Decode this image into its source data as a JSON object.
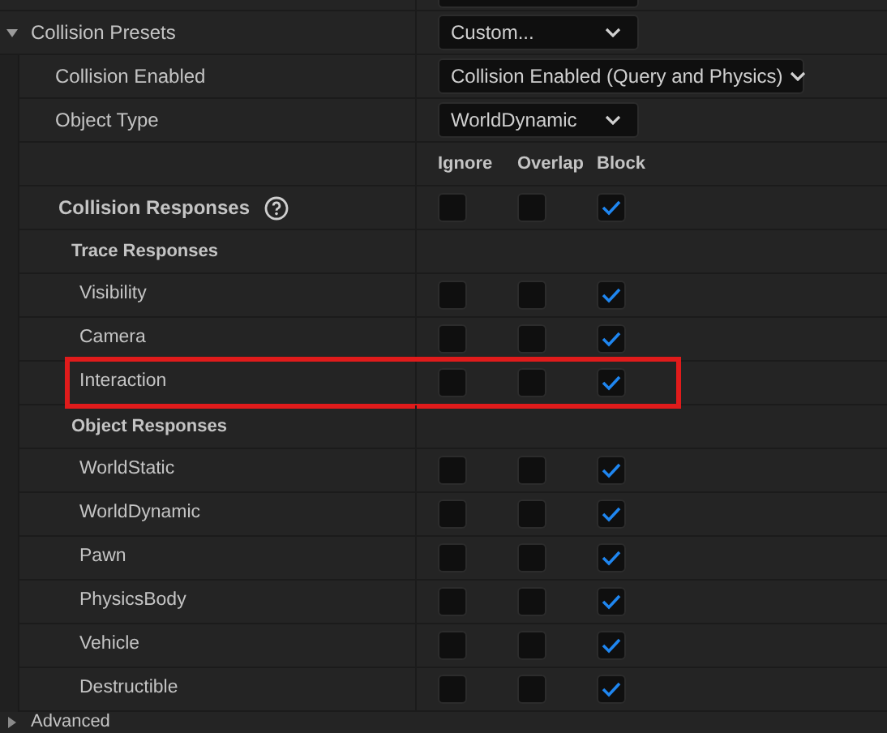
{
  "presets": {
    "label": "Collision Presets",
    "value": "Custom...",
    "expanded": true
  },
  "properties": [
    {
      "label": "Collision Enabled",
      "value": "Collision Enabled (Query and Physics)",
      "wide": true
    },
    {
      "label": "Object Type",
      "value": "WorldDynamic",
      "wide": false
    }
  ],
  "columns": [
    "Ignore",
    "Overlap",
    "Block"
  ],
  "responses": {
    "label": "Collision Responses",
    "ignore": false,
    "overlap": false,
    "block": true
  },
  "groups": [
    {
      "title": "Trace Responses",
      "items": [
        {
          "label": "Visibility",
          "ignore": false,
          "overlap": false,
          "block": true,
          "highlighted": false
        },
        {
          "label": "Camera",
          "ignore": false,
          "overlap": false,
          "block": true,
          "highlighted": false
        },
        {
          "label": "Interaction",
          "ignore": false,
          "overlap": false,
          "block": true,
          "highlighted": true
        }
      ]
    },
    {
      "title": "Object Responses",
      "items": [
        {
          "label": "WorldStatic",
          "ignore": false,
          "overlap": false,
          "block": true,
          "highlighted": false
        },
        {
          "label": "WorldDynamic",
          "ignore": false,
          "overlap": false,
          "block": true,
          "highlighted": false
        },
        {
          "label": "Pawn",
          "ignore": false,
          "overlap": false,
          "block": true,
          "highlighted": false
        },
        {
          "label": "PhysicsBody",
          "ignore": false,
          "overlap": false,
          "block": true,
          "highlighted": false
        },
        {
          "label": "Vehicle",
          "ignore": false,
          "overlap": false,
          "block": true,
          "highlighted": false
        },
        {
          "label": "Destructible",
          "ignore": false,
          "overlap": false,
          "block": true,
          "highlighted": false
        }
      ]
    }
  ],
  "advanced": {
    "label": "Advanced",
    "expanded": false
  }
}
